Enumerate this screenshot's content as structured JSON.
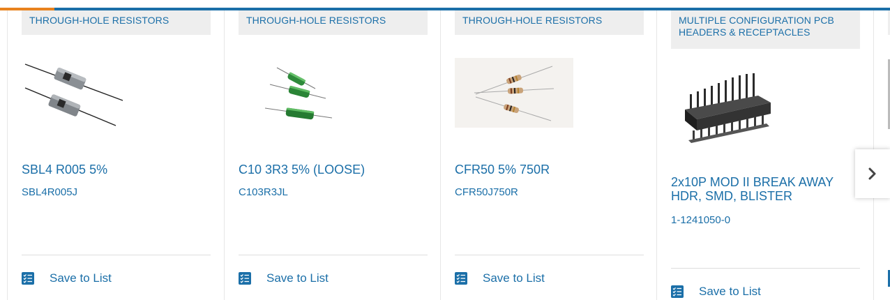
{
  "products": [
    {
      "category": "THROUGH-HOLE RESISTORS",
      "title": "SBL4 R005 5%",
      "part_number": "SBL4R005J",
      "image": "gray-block-resistor",
      "save_label": "Save to List"
    },
    {
      "category": "THROUGH-HOLE RESISTORS",
      "title": "C10 3R3 5% (LOOSE)",
      "part_number": "C103R3JL",
      "image": "green-wirewound-resistor",
      "save_label": "Save to List"
    },
    {
      "category": "THROUGH-HOLE RESISTORS",
      "title": "CFR50 5% 750R",
      "part_number": "CFR50J750R",
      "image": "carbon-film-resistor",
      "save_label": "Save to List"
    },
    {
      "category": "MULTIPLE CONFIGURATION PCB HEADERS & RECEPTACLES",
      "title": "2x10P MOD II BREAK AWAY HDR, SMD, BLISTER",
      "part_number": "1-1241050-0",
      "image": "pin-header",
      "save_label": "Save to List"
    }
  ],
  "colors": {
    "accent": "#e8821e",
    "brand": "#1b6fa8",
    "category_bg": "#eeeeee"
  },
  "icons": {
    "save": "checklist-icon",
    "next": "chevron-right-icon"
  }
}
